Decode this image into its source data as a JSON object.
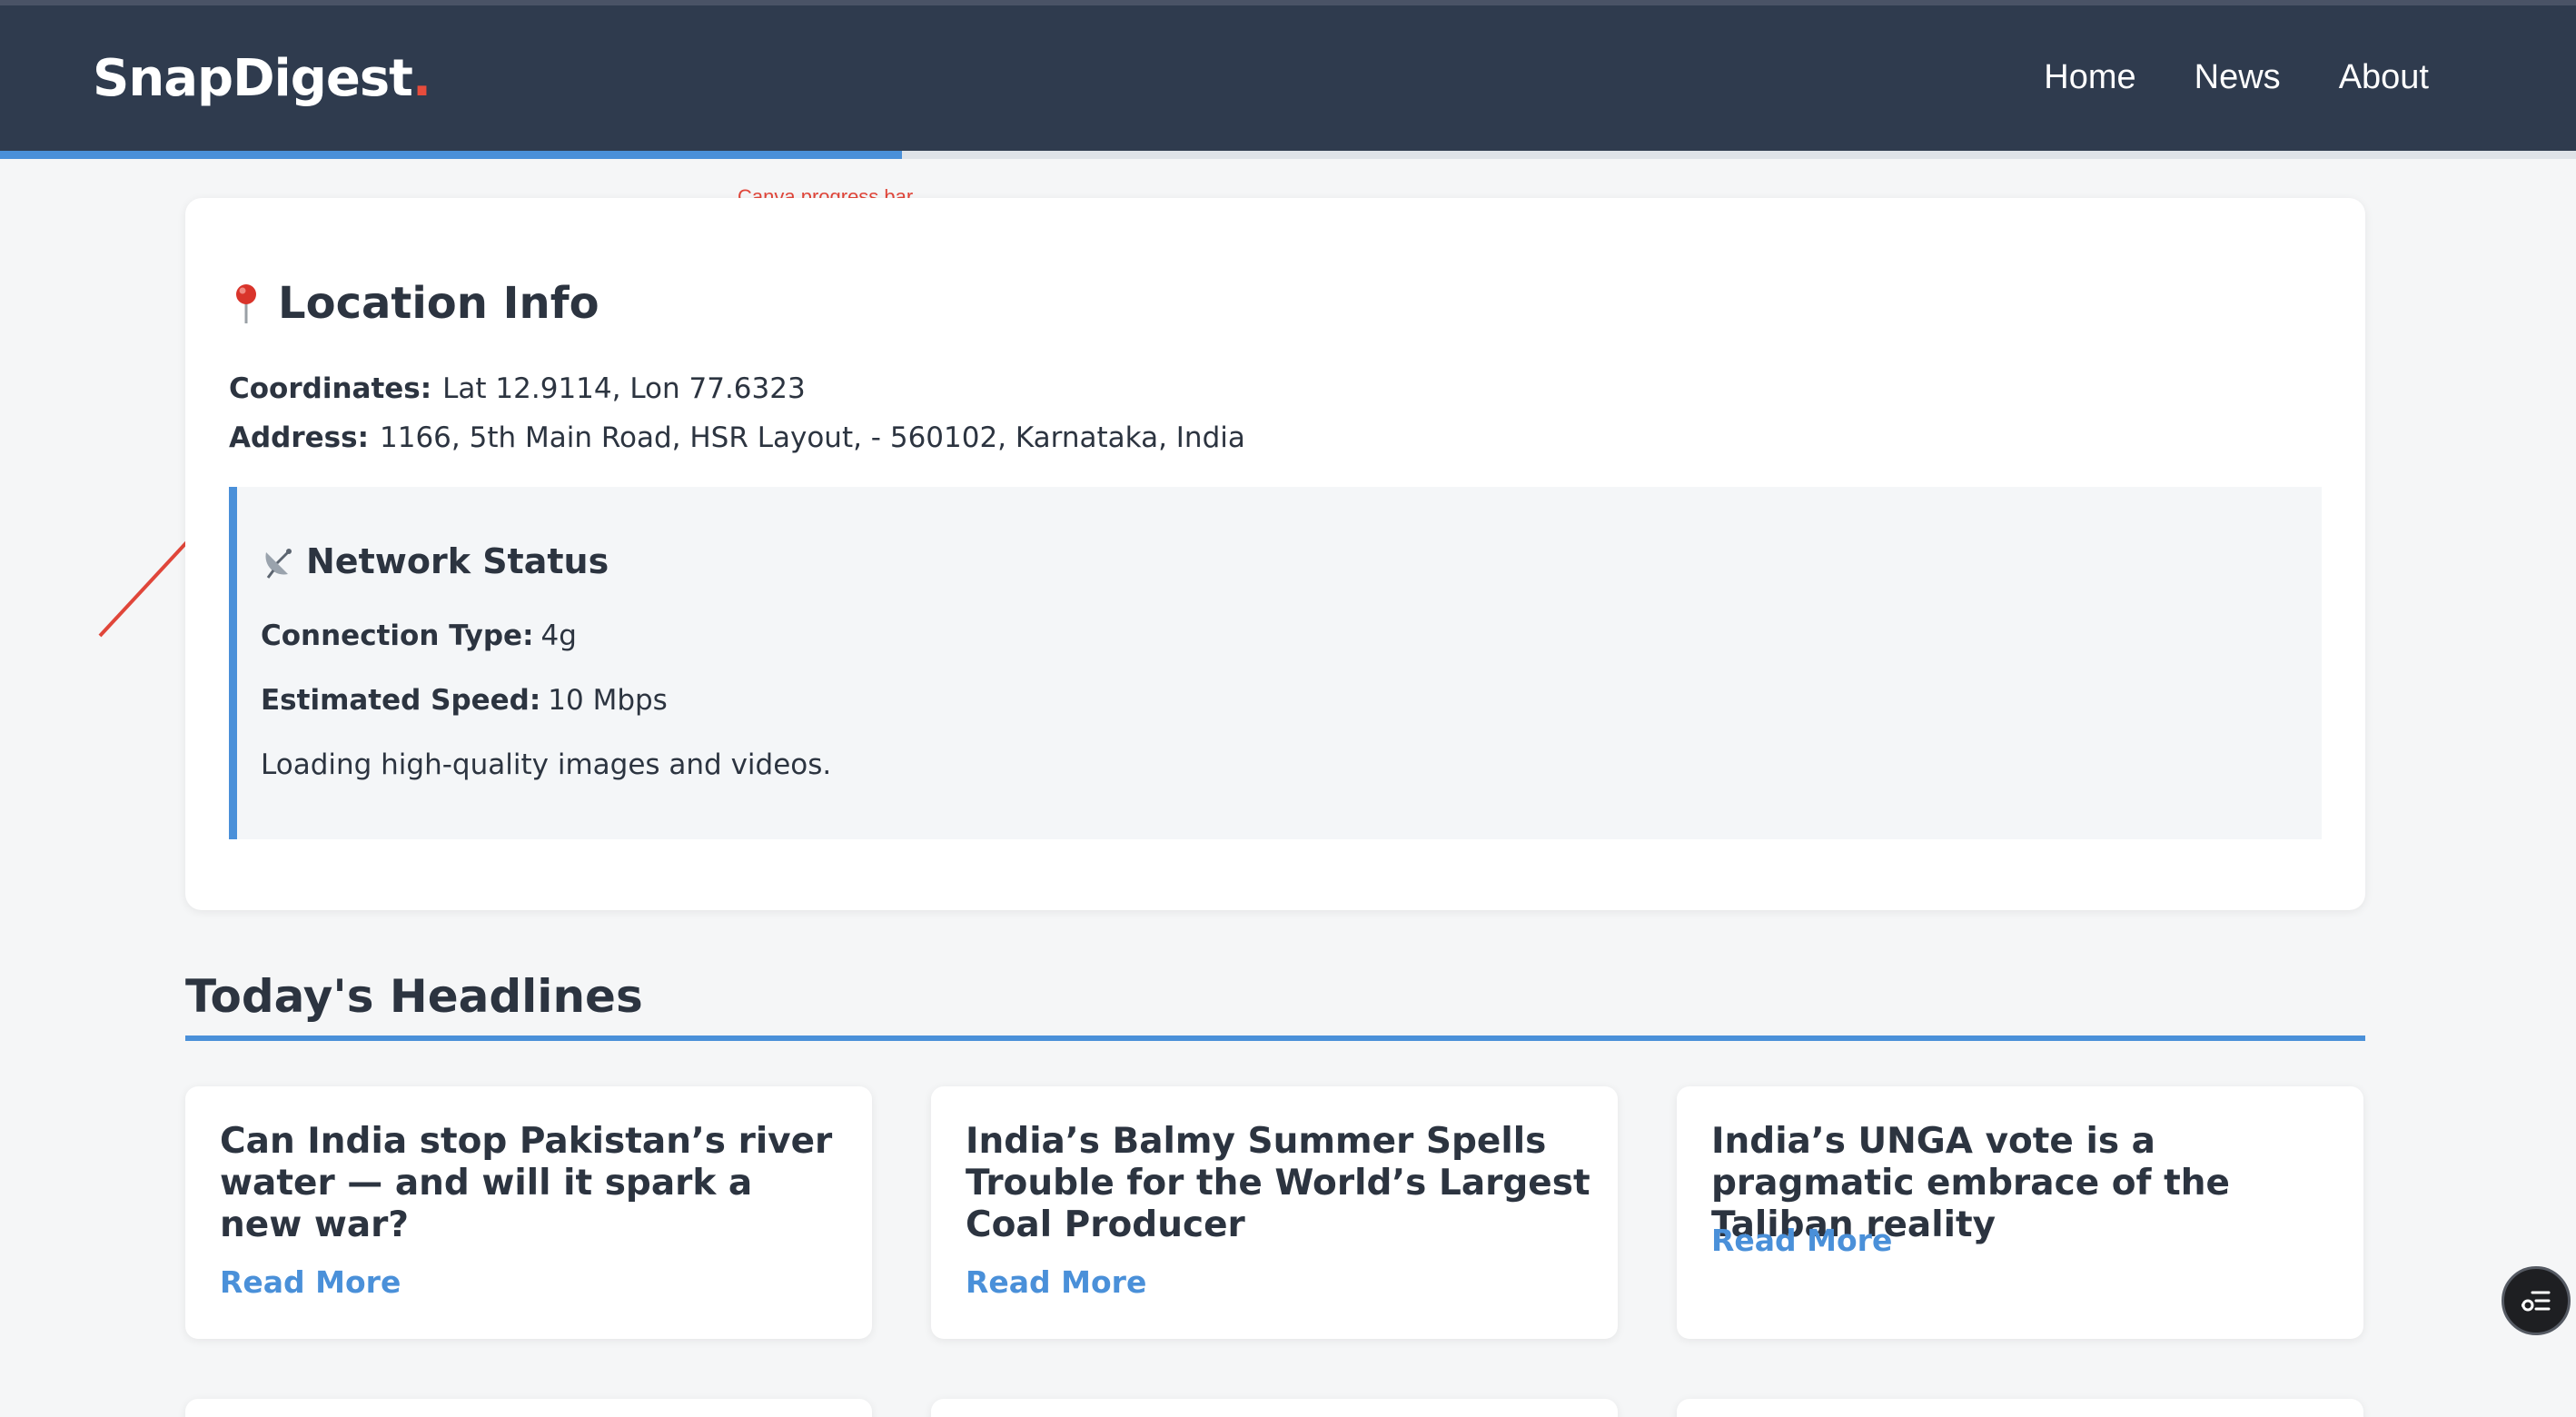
{
  "header": {
    "logo_text": "SnapDigest",
    "logo_dot": ".",
    "nav": [
      {
        "label": "Home"
      },
      {
        "label": "News"
      },
      {
        "label": "About"
      }
    ],
    "progress": 0.35
  },
  "annotation": {
    "label": "Canva progress bar"
  },
  "location": {
    "title": "Location Info",
    "coordinates_label": "Coordinates:",
    "coordinates_value": "Lat 12.9114, Lon 77.6323",
    "address_label": "Address:",
    "address_value": "1166, 5th Main Road, HSR Layout, - 560102, Karnataka, India",
    "network": {
      "title": "Network Status",
      "connection_label": "Connection Type:",
      "connection_value": "4g",
      "speed_label": "Estimated Speed:",
      "speed_value": "10 Mbps",
      "message": "Loading high-quality images and videos."
    }
  },
  "headlines": {
    "title": "Today's Headlines",
    "items": [
      {
        "title": "Can India stop Pakistan’s river water — and will it spark a new war?",
        "link": "Read More"
      },
      {
        "title": "India’s Balmy Summer Spells Trouble for the World’s Largest Coal Producer",
        "link": "Read More"
      },
      {
        "title": "India’s UNGA vote is a pragmatic embrace of the Taliban reality",
        "link": "Read More"
      }
    ]
  },
  "colors": {
    "header_bg": "#2f3b4e",
    "accent": "#4a90d9",
    "logo_dot": "#e74c3c",
    "annotation": "#e0463a"
  },
  "icons": {
    "location": "pin-icon",
    "network": "satellite-dish-icon",
    "fab": "list-settings-icon"
  }
}
